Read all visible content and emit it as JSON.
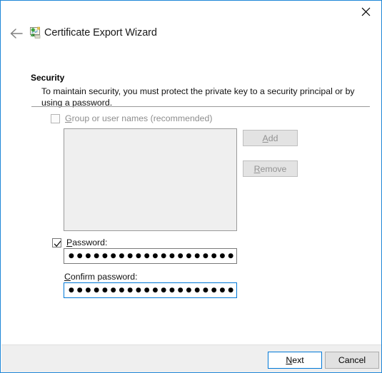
{
  "window": {
    "title": "Certificate Export Wizard",
    "app_icon": "certificate-icon",
    "back_icon": "back-arrow-icon",
    "close_icon": "close-icon",
    "accent_color": "#1f87d8"
  },
  "page": {
    "heading": "Security",
    "description": "To maintain security, you must protect the private key to a security principal or by using a password."
  },
  "group_users": {
    "checkbox_label_pre": "G",
    "checkbox_label_post": "roup or user names (recommended)",
    "checked": false,
    "enabled": false,
    "list_items": [],
    "add_label_pre": "A",
    "add_label_post": "dd",
    "remove_label_pre": "R",
    "remove_label_post": "emove",
    "buttons_enabled": false
  },
  "password": {
    "checkbox_label_pre": "P",
    "checkbox_label_post": "assword:",
    "checked": true,
    "value": "●●●●●●●●●●●●●●●●●●●●●●●",
    "confirm_label_pre": "C",
    "confirm_label_post": "onfirm password:",
    "confirm_value": "●●●●●●●●●●●●●●●●●●●●●●●",
    "confirm_focused": true
  },
  "footer": {
    "next_label_pre": "N",
    "next_label_post": "ext",
    "cancel_label": "Cancel"
  }
}
